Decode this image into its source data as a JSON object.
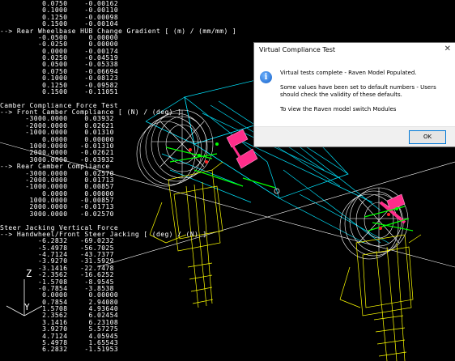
{
  "text_lines": [
    "          0.0750    -0.00162",
    "          0.1000    -0.00110",
    "          0.1250    -0.00098",
    "          0.1500    -0.00104",
    "--> Rear Wheelbase HUB Change Gradient [ (m) / (mm/mm) ]",
    "         -0.0500     0.00000",
    "         -0.0250     0.00000",
    "          0.0000    -0.00174",
    "          0.0250    -0.04519",
    "          0.0500    -0.05338",
    "          0.0750    -0.06694",
    "          0.1000    -0.08123",
    "          0.1250    -0.09582",
    "          0.1500    -0.11051",
    "",
    "Camber Compliance Force Test",
    "--> Front Camber Compliance [ (N) / (deg) ]",
    "      -3000.0000    0.03932",
    "      -2000.0000    0.02621",
    "      -1000.0000    0.01310",
    "          0.0000    0.00000",
    "       1000.0000   -0.01310",
    "       2000.0000   -0.02621",
    "       3000.0000   -0.03932",
    "--> Rear Camber Compliance",
    "      -3000.0000    0.02570",
    "      -2000.0000    0.01713",
    "      -1000.0000    0.00857",
    "          0.0000    0.00000",
    "       1000.0000   -0.00857",
    "       2000.0000   -0.01713",
    "       3000.0000   -0.02570",
    "",
    "Steer Jacking Vertical Force",
    "--> Handwheel/Front Steer Jacking [ (deg) / (N) ]",
    "         -6.2832   -69.0232",
    "         -5.4978   -56.7025",
    "         -4.7124   -43.7377",
    "         -3.9270   -31.5929",
    "         -3.1416   -22.7478",
    "         -2.3562   -16.6252",
    "         -1.5708    -8.9545",
    "         -0.7854    -3.8538",
    "          0.0000     0.00000",
    "          0.7854     2.94080",
    "          1.5708     4.93640",
    "          2.3562     6.02454",
    "          3.1416     6.23108",
    "          3.9270     5.57275",
    "          4.7124     4.05945",
    "          5.4978     1.65543",
    "          6.2832    -1.51953"
  ],
  "axis": {
    "z_label": "Z",
    "y_label": "Y"
  },
  "dialog": {
    "title": "Virtual Compliance Test",
    "close_glyph": "✕",
    "icon_glyph": "i",
    "icon_name": "info-icon",
    "msg1": "Virtual tests complete - Raven Model Populated.",
    "msg2a": "Some values have been set to default numbers - Users",
    "msg2b": "should check the validity of these defaults.",
    "msg3": "To view the Raven model switch Modules",
    "ok_label": "OK"
  },
  "colors": {
    "wire_cyan": "#00e5ff",
    "wire_yellow": "#ffff00",
    "wire_white": "#ffffff",
    "spring_pink": "#ff2d8a",
    "arm_green": "#00ff00",
    "accent_red": "#ff2020"
  }
}
